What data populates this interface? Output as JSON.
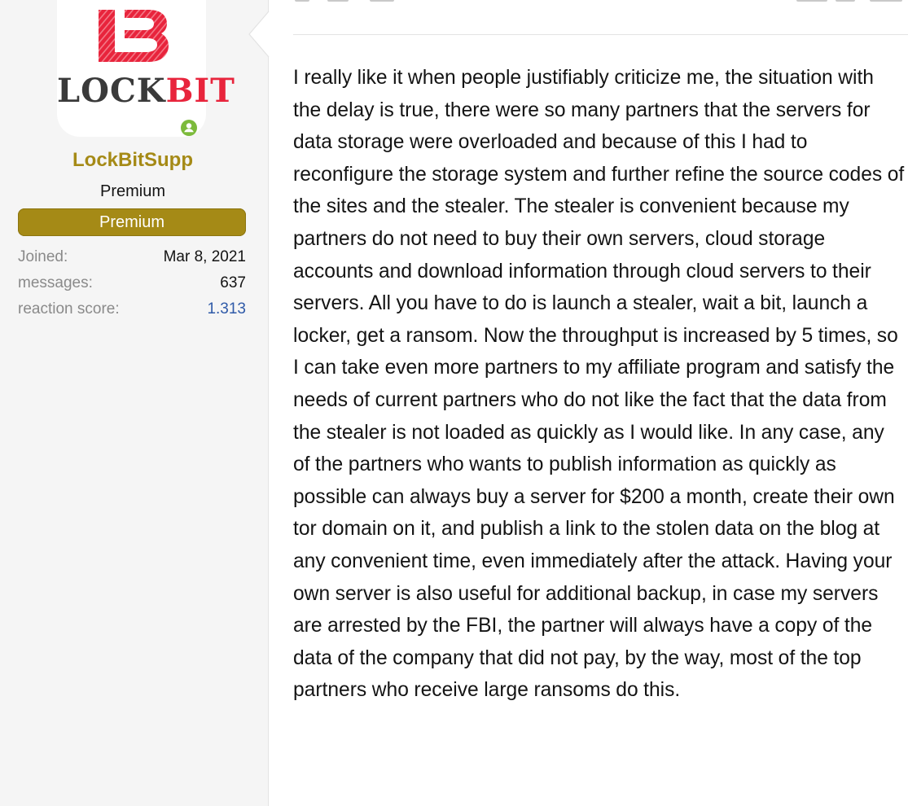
{
  "user": {
    "logo_text": "LOCKBIT",
    "logo_text_part1": "LOCK",
    "logo_text_part2": "BIT",
    "username": "LockBitSupp",
    "user_title": "Premium",
    "banner": "Premium",
    "status_icon": "online-user-icon",
    "stats": [
      {
        "label": "Joined:",
        "value": "Mar 8, 2021"
      },
      {
        "label": "messages:",
        "value": "637"
      },
      {
        "label": "reaction score:",
        "value": "1.313"
      }
    ]
  },
  "post": {
    "body": "I really like it when people justifiably criticize me, the situation with the delay is true, there were so many partners that the servers for data storage were overloaded and because of this I had to reconfigure the storage system and further refine the source codes of the sites and the stealer. The stealer is convenient because my partners do not need to buy their own servers, cloud storage accounts and download information through cloud servers to their servers. All you have to do is launch a stealer, wait a bit, launch a locker, get a ransom. Now the throughput is increased by 5 times, so I can take even more partners to my affiliate program and satisfy the needs of current partners who do not like the fact that the data from the stealer is not loaded as quickly as I would like. In any case, any of the partners who wants to publish information as quickly as possible can always buy a server for $200 a month, create their own tor domain on it, and publish a link to the stolen data on the blog at any convenient time, even immediately after the attack. Having your own server is also useful for additional backup, in case my servers are arrested by the FBI, the partner will always have a copy of the data of the company that did not pay, by the way, most of the top partners who receive large ransoms do this."
  },
  "colors": {
    "brand_red": "#e8243c",
    "username_gold": "#a58a16",
    "online_green": "#7cba3b",
    "link_blue": "#2f5aa8"
  }
}
